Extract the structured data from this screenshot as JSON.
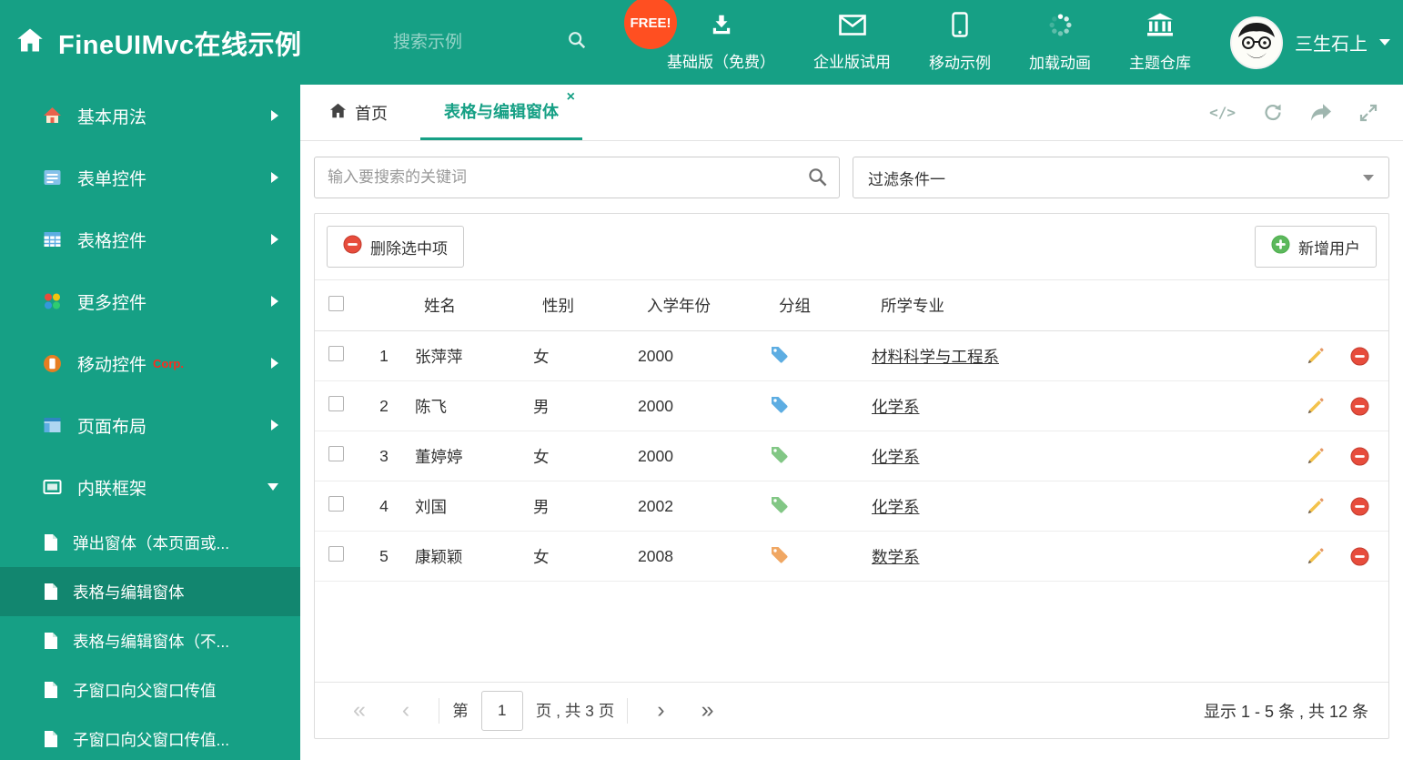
{
  "colors": {
    "theme": "#16a085",
    "free_badge": "#ff4f21",
    "delete_red": "#e74c3c",
    "add_green": "#5cb85c"
  },
  "header": {
    "title": "FineUIMvc在线示例",
    "search_placeholder": "搜索示例",
    "free_badge": "FREE!",
    "nav_items": [
      {
        "label": "基础版（免费）"
      },
      {
        "label": "企业版试用"
      },
      {
        "label": "移动示例"
      },
      {
        "label": "加载动画"
      },
      {
        "label": "主题仓库"
      }
    ],
    "user_name": "三生石上"
  },
  "sidebar": {
    "items": [
      {
        "label": "基本用法"
      },
      {
        "label": "表单控件"
      },
      {
        "label": "表格控件"
      },
      {
        "label": "更多控件"
      },
      {
        "label": "移动控件",
        "badge": "Corp."
      },
      {
        "label": "页面布局"
      },
      {
        "label": "内联框架"
      }
    ],
    "sub_items": [
      {
        "label": "弹出窗体（本页面或..."
      },
      {
        "label": "表格与编辑窗体"
      },
      {
        "label": "表格与编辑窗体（不..."
      },
      {
        "label": "子窗口向父窗口传值"
      },
      {
        "label": "子窗口向父窗口传值..."
      }
    ]
  },
  "tabs": {
    "home": "首页",
    "active": "表格与编辑窗体",
    "close_glyph": "×"
  },
  "tools": {
    "code_glyph": "</>"
  },
  "filter": {
    "search_placeholder": "输入要搜索的关键词",
    "dropdown_value": "过滤条件一"
  },
  "toolbar": {
    "delete_label": "删除选中项",
    "add_label": "新增用户"
  },
  "table": {
    "headers": {
      "name": "姓名",
      "gender": "性别",
      "year": "入学年份",
      "group": "分组",
      "major": "所学专业"
    },
    "rows": [
      {
        "num": "1",
        "name": "张萍萍",
        "gender": "女",
        "year": "2000",
        "tag_color": "#5dade2",
        "major": "材料科学与工程系"
      },
      {
        "num": "2",
        "name": "陈飞",
        "gender": "男",
        "year": "2000",
        "tag_color": "#5dade2",
        "major": "化学系"
      },
      {
        "num": "3",
        "name": "董婷婷",
        "gender": "女",
        "year": "2000",
        "tag_color": "#82c785",
        "major": "化学系"
      },
      {
        "num": "4",
        "name": "刘国",
        "gender": "男",
        "year": "2002",
        "tag_color": "#82c785",
        "major": "化学系"
      },
      {
        "num": "5",
        "name": "康颖颖",
        "gender": "女",
        "year": "2008",
        "tag_color": "#f0a763",
        "major": "数学系"
      }
    ]
  },
  "pagination": {
    "first_glyph": "«",
    "prev_glyph": "‹",
    "label_page": "第",
    "current_page": "1",
    "label_total": "页 , 共 3 页",
    "next_glyph": "›",
    "last_glyph": "»",
    "summary": "显示 1 - 5 条 , 共 12 条"
  }
}
